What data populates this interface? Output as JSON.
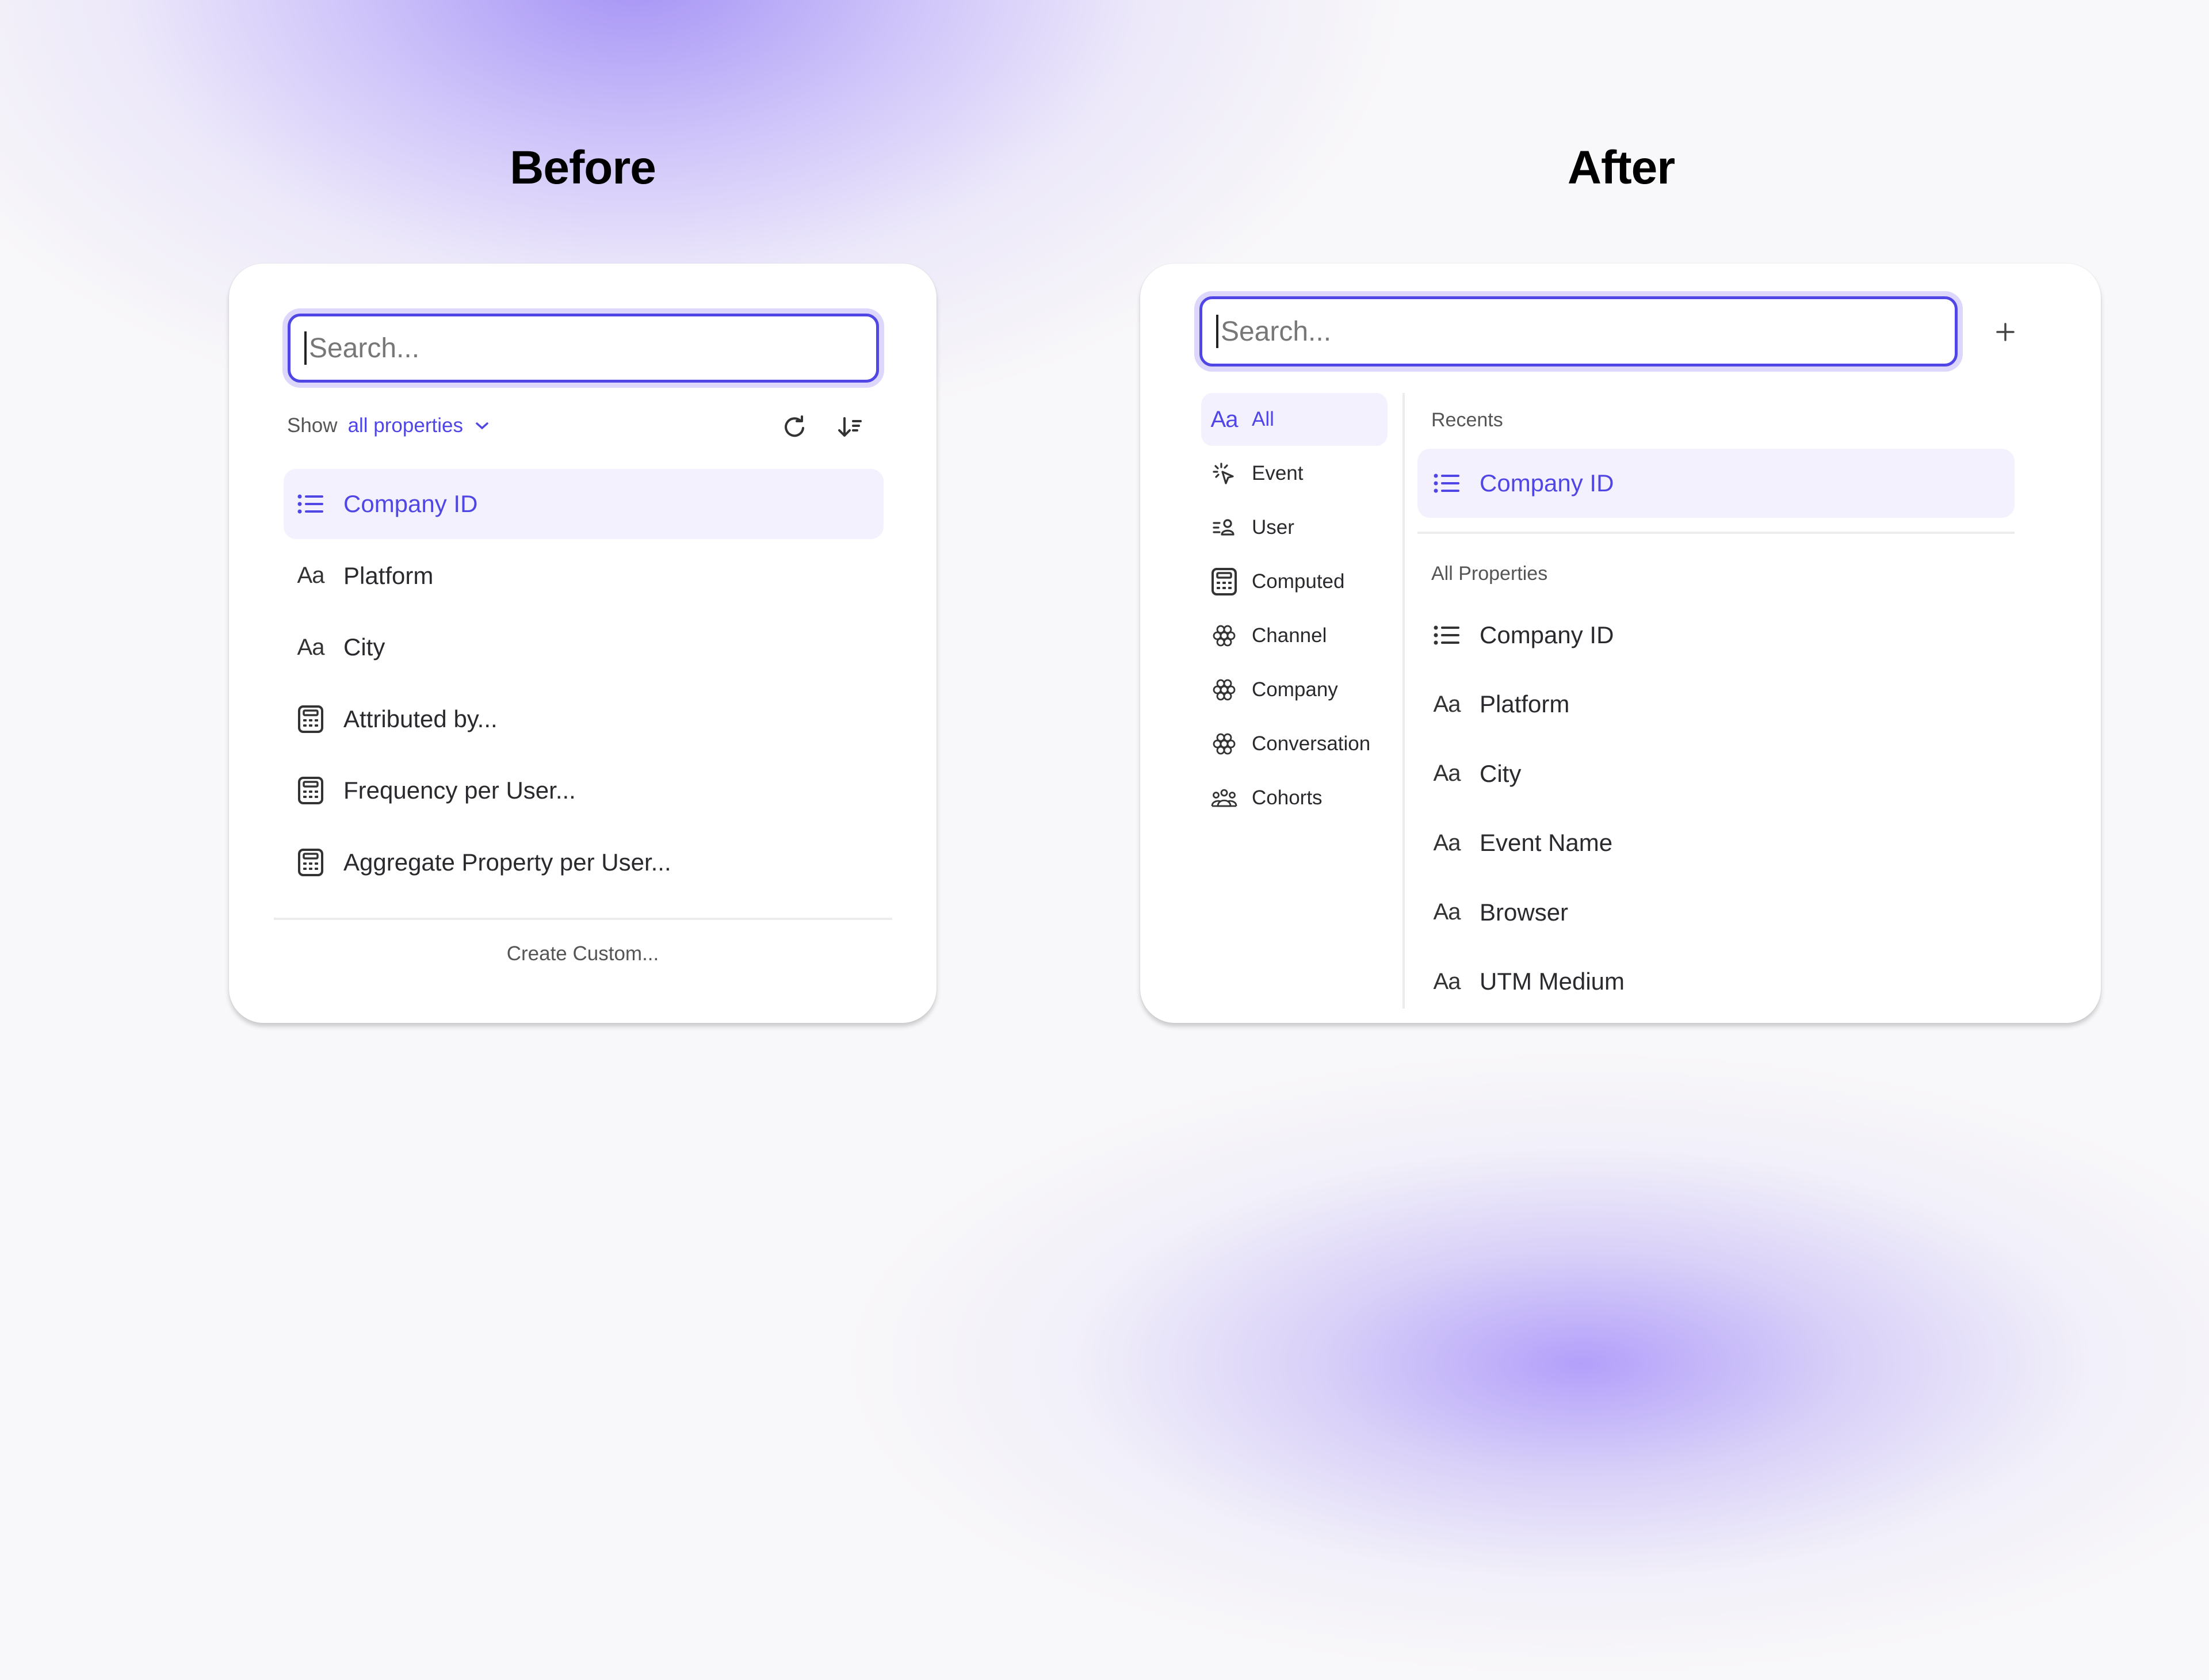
{
  "headings": {
    "before": "Before",
    "after": "After"
  },
  "colors": {
    "accent": "#4f46e5",
    "selected_bg": "#f3f1fd",
    "text": "#2a2a2e",
    "muted": "#666666"
  },
  "before": {
    "search": {
      "placeholder": "Search...",
      "value": ""
    },
    "filter": {
      "prefix": "Show",
      "value": "all properties"
    },
    "icons": {
      "refresh": "refresh-icon",
      "sort": "sort-descending-icon"
    },
    "items": [
      {
        "icon": "list-icon",
        "label": "Company ID",
        "selected": true
      },
      {
        "icon": "text-type-icon",
        "label": "Platform"
      },
      {
        "icon": "text-type-icon",
        "label": "City"
      },
      {
        "icon": "calculator-icon",
        "label": "Attributed by..."
      },
      {
        "icon": "calculator-icon",
        "label": "Frequency per User..."
      },
      {
        "icon": "calculator-icon",
        "label": "Aggregate Property per User..."
      }
    ],
    "footer": {
      "create_custom": "Create Custom..."
    }
  },
  "after": {
    "search": {
      "placeholder": "Search...",
      "value": ""
    },
    "add_icon": "plus-icon",
    "nav": [
      {
        "icon": "text-type-icon",
        "label": "All",
        "selected": true
      },
      {
        "icon": "event-cursor-icon",
        "label": "Event"
      },
      {
        "icon": "user-list-icon",
        "label": "User"
      },
      {
        "icon": "calculator-icon",
        "label": "Computed"
      },
      {
        "icon": "flower-icon",
        "label": "Channel"
      },
      {
        "icon": "flower-icon",
        "label": "Company"
      },
      {
        "icon": "flower-icon",
        "label": "Conversation"
      },
      {
        "icon": "group-icon",
        "label": "Cohorts"
      }
    ],
    "recents": {
      "heading": "Recents",
      "items": [
        {
          "icon": "list-icon",
          "label": "Company ID",
          "selected": true
        }
      ]
    },
    "all_properties": {
      "heading": "All Properties",
      "items": [
        {
          "icon": "list-icon",
          "label": "Company ID"
        },
        {
          "icon": "text-type-icon",
          "label": "Platform"
        },
        {
          "icon": "text-type-icon",
          "label": "City"
        },
        {
          "icon": "text-type-icon",
          "label": "Event Name"
        },
        {
          "icon": "text-type-icon",
          "label": "Browser"
        },
        {
          "icon": "text-type-icon",
          "label": "UTM Medium"
        }
      ]
    }
  }
}
